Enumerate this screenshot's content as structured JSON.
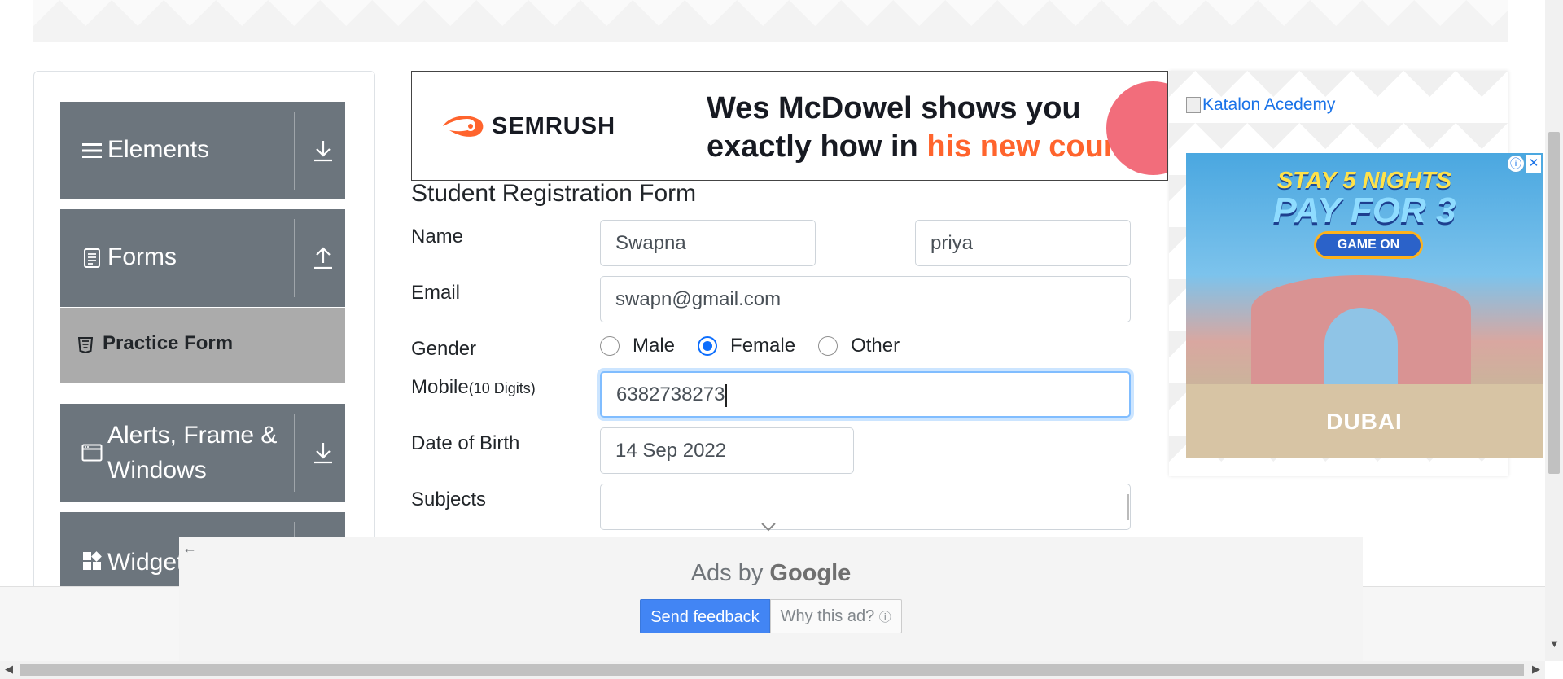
{
  "sidebar": {
    "groups": [
      {
        "label": "Elements",
        "icon": "menu-icon",
        "arrow": "download-icon"
      },
      {
        "label": "Forms",
        "icon": "document-icon",
        "arrow": "upload-icon"
      },
      {
        "label": "Alerts, Frame &",
        "label_line2": "Windows",
        "icon": "window-icon",
        "arrow": "download-icon"
      },
      {
        "label": "Widgets",
        "icon": "widgets-icon",
        "arrow": "download-icon"
      }
    ],
    "active_item": {
      "label": "Practice Form",
      "icon": "html5-icon"
    }
  },
  "top_ad": {
    "brand": "SEMRUSH",
    "headline_line1": "Wes McDowel shows you",
    "headline_line2_part1": "exactly how in ",
    "headline_line2_highlight": "his new course",
    "highlight_color": "#ff642d"
  },
  "form": {
    "title": "Student Registration Form",
    "name_label": "Name",
    "first_name": "Swapna",
    "last_name": "priya",
    "email_label": "Email",
    "email": "swapn@gmail.com",
    "gender_label": "Gender",
    "gender_options": [
      "Male",
      "Female",
      "Other"
    ],
    "gender_selected": "Female",
    "mobile_label": "Mobile",
    "mobile_hint": "(10 Digits)",
    "mobile": "6382738273",
    "dob_label": "Date of Birth",
    "dob": "14 Sep 2022",
    "subjects_label": "Subjects",
    "subjects": ""
  },
  "right_ad": {
    "broken_image_alt": "Katalon Acedemy",
    "headline_line1": "STAY 5 NIGHTS",
    "headline_line2": "PAY FOR 3",
    "cta": "GAME ON",
    "city": "DUBAI",
    "adchoices": "ⓘ",
    "close": "✕"
  },
  "google_ad": {
    "ads_by_prefix": "Ads by ",
    "ads_by_brand": "Google",
    "send_feedback": "Send feedback",
    "why_this_ad": "Why this ad?"
  },
  "colors": {
    "sidebar_group": "#6c757d",
    "active_item": "#ababab",
    "radio_checked": "#0d6efd",
    "focus_border": "#80bdff",
    "send_feedback_bg": "#4285f4"
  }
}
